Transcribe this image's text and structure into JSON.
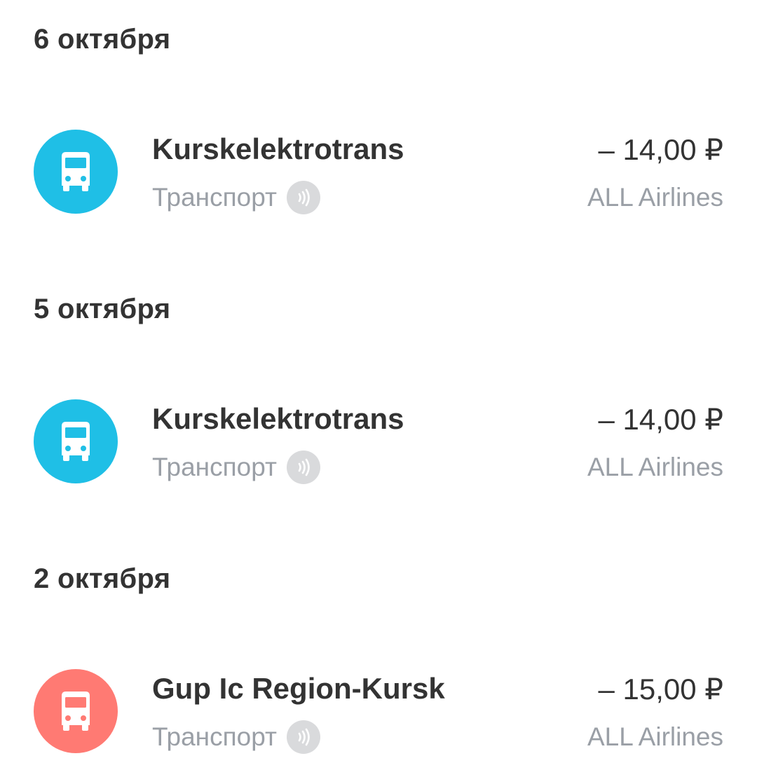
{
  "sections": [
    {
      "date": "6 октября",
      "transaction": {
        "merchant": "Kurskelektrotrans",
        "category": "Транспорт",
        "amount": "– 14,00 ₽",
        "account": "ALL Airlines",
        "icon": "bus-icon",
        "icon_color": "#1fbfe6",
        "payment_method_icon": "contactless-icon"
      }
    },
    {
      "date": "5 октября",
      "transaction": {
        "merchant": "Kurskelektrotrans",
        "category": "Транспорт",
        "amount": "– 14,00 ₽",
        "account": "ALL Airlines",
        "icon": "bus-icon",
        "icon_color": "#1fbfe6",
        "payment_method_icon": "contactless-icon"
      }
    },
    {
      "date": "2 октября",
      "transaction": {
        "merchant": "Gup Ic Region-Kursk",
        "category": "Транспорт",
        "amount": "– 15,00 ₽",
        "account": "ALL Airlines",
        "icon": "bus-icon",
        "icon_color": "#ff7a73",
        "payment_method_icon": "contactless-icon"
      }
    }
  ]
}
